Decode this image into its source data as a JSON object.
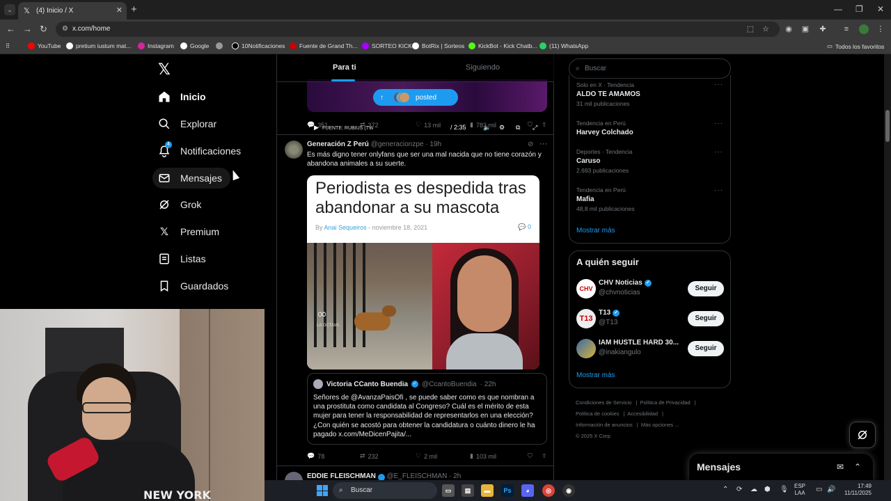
{
  "browser": {
    "tab_title": "(4) Inicio / X",
    "url": "x.com/home",
    "bookmarks": [
      "YouTube",
      "pretium iustum mat...",
      "Instagram",
      "Google",
      "10Notificaciones",
      "Fuente de Grand Th...",
      "SORTEO KICK",
      "BotRix | Sorteos",
      "KickBot - Kick Chatb...",
      "(11) WhatsApp"
    ],
    "all_bookmarks": "Todos los favoritos"
  },
  "nav": {
    "items": [
      {
        "label": "Inicio",
        "icon": "home-icon"
      },
      {
        "label": "Explorar",
        "icon": "search-icon"
      },
      {
        "label": "Notificaciones",
        "icon": "bell-icon",
        "badge": "4"
      },
      {
        "label": "Mensajes",
        "icon": "envelope-icon"
      },
      {
        "label": "Grok",
        "icon": "grok-icon"
      },
      {
        "label": "Premium",
        "icon": "x-icon"
      },
      {
        "label": "Listas",
        "icon": "list-icon"
      },
      {
        "label": "Guardados",
        "icon": "bookmark-icon"
      }
    ]
  },
  "feed": {
    "tabs": [
      "Para ti",
      "Siguiendo"
    ],
    "video": {
      "source": "FUENTE: RUBIUS (TW",
      "time": "/ 2:35",
      "posted": "posted"
    },
    "prev_actions": {
      "replies": "351",
      "reposts": "372",
      "likes": "13 mil",
      "views": "783 mil"
    },
    "tweet": {
      "name": "Generación Z Perú",
      "handle": "@generacionzpe",
      "time": "· 19h",
      "text": "Es más digno tener onlyfans que ser una mal nacida que no tiene corazón y abandona animales a su suerte.",
      "card": {
        "title": "Periodista es despedida tras abandonar a su mascota",
        "by": "By",
        "author": "Anai Sequeiros",
        "date": "- noviembre 18, 2021",
        "comments": "0",
        "logo_text": "LA OCTAVA"
      },
      "quote": {
        "name": "Victoria CCanto Buendia",
        "handle": "@CcantoBuendia",
        "time": "· 22h",
        "text": "Señores de @AvanzaPaisOfi , se puede saber como es que nombran a una prostituta como candidata al Congreso? Cuál es el mérito de esta mujer para tener la responsabilidad de representarlos en una elección? ¿Con quién se acostó para obtener la candidatura o cuánto dinero le ha pagado x.com/MeDicenPajita/..."
      },
      "actions": {
        "replies": "78",
        "reposts": "232",
        "likes": "2 mil",
        "views": "103 mil"
      }
    },
    "next": {
      "name": "EDDIE FLEISCHMAN",
      "handle": "@E_FLEISCHMAN",
      "time": "· 2h"
    }
  },
  "sidebar": {
    "search_placeholder": "Buscar",
    "trends": [
      {
        "context": "Solo en X · Tendencia",
        "name": "ALDO TE AMAMOS",
        "count": "31 mil publicaciones"
      },
      {
        "context": "Tendencia en Perú",
        "name": "Harvey Colchado",
        "count": ""
      },
      {
        "context": "Deportes · Tendencia",
        "name": "Caruso",
        "count": "2.693 publicaciones"
      },
      {
        "context": "Tendencia en Perú",
        "name": "Mafia",
        "count": "48,8 mil publicaciones"
      }
    ],
    "trends_more": "Mostrar más",
    "follow_title": "A quién seguir",
    "follow": [
      {
        "name": "CHV Noticias",
        "handle": "@chvnoticias",
        "verified": true,
        "btn": "Seguir"
      },
      {
        "name": "T13",
        "handle": "@T13",
        "verified": true,
        "btn": "Seguir"
      },
      {
        "name": "IAM HUSTLE HARD 30...",
        "handle": "@inakiangulo",
        "verified": false,
        "btn": "Seguir"
      }
    ],
    "follow_more": "Mostrar más",
    "footer": [
      "Condiciones de Servicio",
      "Política de Privacidad",
      "Política de cookies",
      "Accesibilidad",
      "Información de anuncios",
      "Más opciones ...",
      "© 2025 X Corp."
    ]
  },
  "messages_drawer": "Mensajes",
  "webcam": {
    "shirt_text": "NEW YORK"
  },
  "taskbar": {
    "search": "Buscar",
    "lang_top": "ESP",
    "lang_bottom": "LAA",
    "time": "17:49",
    "date": "11/11/2025"
  }
}
